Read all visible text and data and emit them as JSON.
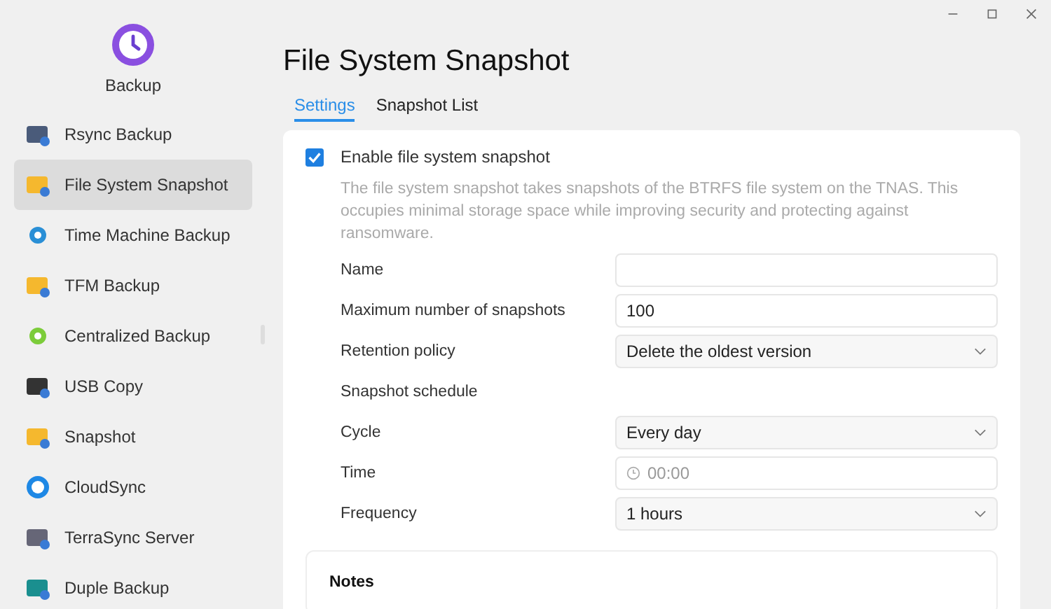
{
  "app": {
    "name": "Backup"
  },
  "sidebar": {
    "items": [
      {
        "label": "Rsync Backup",
        "selected": false
      },
      {
        "label": "File System Snapshot",
        "selected": true
      },
      {
        "label": "Time Machine Backup",
        "selected": false
      },
      {
        "label": "TFM Backup",
        "selected": false
      },
      {
        "label": "Centralized Backup",
        "selected": false
      },
      {
        "label": "USB Copy",
        "selected": false
      },
      {
        "label": "Snapshot",
        "selected": false
      },
      {
        "label": "CloudSync",
        "selected": false
      },
      {
        "label": "TerraSync Server",
        "selected": false
      },
      {
        "label": "Duple Backup",
        "selected": false
      }
    ]
  },
  "page": {
    "title": "File System Snapshot"
  },
  "tabs": [
    {
      "label": "Settings",
      "selected": true
    },
    {
      "label": "Snapshot List",
      "selected": false
    }
  ],
  "enable": {
    "label": "Enable file system snapshot",
    "checked": true
  },
  "description": "The file system snapshot takes snapshots of the BTRFS file system on the TNAS. This occupies minimal storage space while improving security and protecting against ransomware.",
  "fields": [
    {
      "kind": "text",
      "label": "Name"
    },
    {
      "kind": "text",
      "label": "Maximum number of snapshots",
      "value": "100"
    },
    {
      "kind": "select",
      "label": "Retention policy",
      "value": "Delete the oldest version"
    },
    {
      "kind": "heading",
      "label": "Snapshot schedule"
    },
    {
      "kind": "select",
      "label": "Cycle",
      "value": "Every day"
    },
    {
      "kind": "time",
      "label": "Time",
      "placeholder": "00:00"
    },
    {
      "kind": "select",
      "label": "Frequency",
      "value": "1 hours"
    }
  ],
  "notes": {
    "title": "Notes"
  }
}
